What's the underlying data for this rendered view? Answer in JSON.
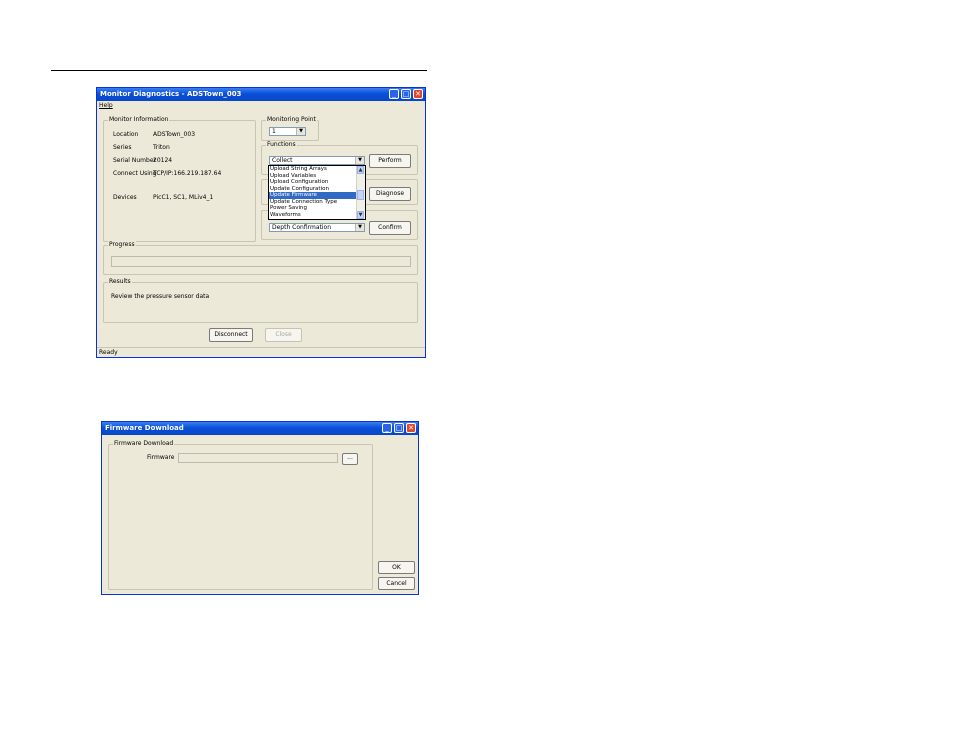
{
  "monitor_window": {
    "title": "Monitor Diagnostics - ADSTown_003",
    "menu": {
      "help": "Help"
    },
    "monitor_info": {
      "group_label": "Monitor Information",
      "fields": [
        {
          "label": "Location",
          "value": "ADSTown_003"
        },
        {
          "label": "Series",
          "value": "Triton"
        },
        {
          "label": "Serial Number",
          "value": "20124"
        },
        {
          "label": "Connect Using",
          "value": "TCP/IP:166.219.187.64"
        },
        {
          "label": "Devices",
          "value": "PicC1, SC1, MLiv4_1"
        }
      ]
    },
    "monitoring_point": {
      "group_label": "Monitoring Point",
      "value": "1"
    },
    "functions": {
      "group_label": "Functions",
      "selected": "Collect",
      "perform_label": "Perform",
      "options": [
        "Upload String Arrays",
        "Upload Variables",
        "Upload Configuration",
        "Update Configuration",
        "Update Firmware",
        "Update Connection Type",
        "Power Saving",
        "Waveforms"
      ],
      "highlighted_option": "Update Firmware"
    },
    "diagnose_label": "Diagnose",
    "confirmation": {
      "selected": "Depth Confirmation",
      "confirm_label": "Confirm"
    },
    "progress": {
      "group_label": "Progress",
      "percent": 0
    },
    "results": {
      "group_label": "Results",
      "text": "Review the pressure sensor data"
    },
    "disconnect_label": "Disconnect",
    "close_label": "Close",
    "status": "Ready"
  },
  "firmware_window": {
    "title": "Firmware Download",
    "group_label": "Firmware Download",
    "firmware_label": "Firmware",
    "firmware_value": "",
    "browse_label": "...",
    "ok_label": "OK",
    "cancel_label": "Cancel"
  },
  "colors": {
    "title_blue": "#0a4fd8",
    "dialog_bg": "#ece9d8",
    "selection": "#316ac5",
    "close_red": "#e0482c"
  }
}
